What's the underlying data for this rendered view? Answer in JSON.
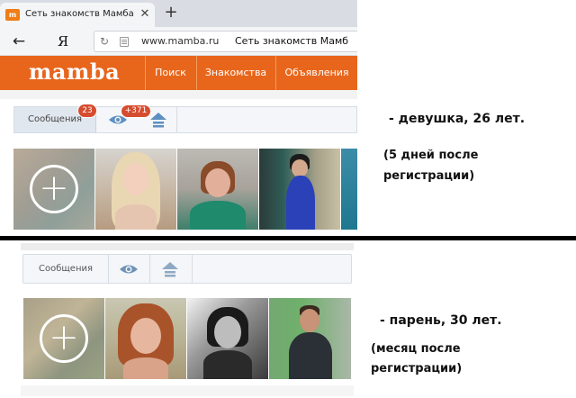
{
  "browser": {
    "tab_title": "Сеть знакомств Мамба /",
    "tab_favicon_text": "m",
    "tab_close": "✕",
    "new_tab": "+",
    "back_glyph": "←",
    "yandex_logo": "Я",
    "reload_glyph": "↻",
    "url_domain": "www.mamba.ru",
    "url_page_title": "Сеть знакомств Мамб"
  },
  "site": {
    "logo": "mamba",
    "brand_color": "#e8661c",
    "nav": [
      "Поиск",
      "Знакомства",
      "Объявления"
    ]
  },
  "top_profile": {
    "messages_label": "Сообщения",
    "messages_badge": "23",
    "views_badge": "+371",
    "add_photo_glyph": "+",
    "annotation": "- девушка, 26 лет.",
    "note_line1": "(5 дней после",
    "note_line2": "регистрации)"
  },
  "bottom_profile": {
    "messages_label": "Сообщения",
    "add_photo_glyph": "+",
    "annotation": "- парень, 30 лет.",
    "note_line1": "(месяц после",
    "note_line2": "регистрации)"
  },
  "colors": {
    "badge": "#d64c2f",
    "divider": "#000000",
    "toolbar_border": "#d6dce4"
  }
}
